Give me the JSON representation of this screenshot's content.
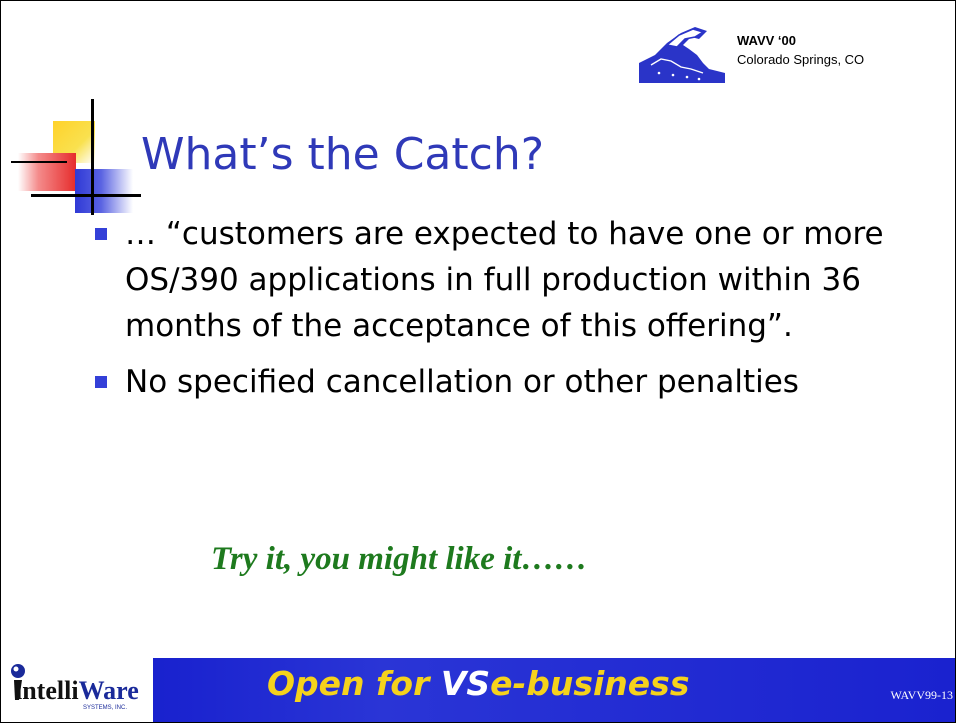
{
  "header": {
    "conference_title": "WAVV ‘00",
    "conference_location": "Colorado Springs, CO",
    "logo_icon": "wavv-mountain-logo"
  },
  "slide": {
    "title": "What’s the Catch?",
    "bullets": [
      "…  “customers are expected to have one or more OS/390 applications in full production within 36 months of the acceptance of this offering”.",
      "No specified cancellation or other penalties"
    ],
    "tagline": "Try it, you might like it……",
    "colors": {
      "title": "#2f39b8",
      "bullet": "#3440d8",
      "tagline": "#1e7a1e"
    }
  },
  "footer": {
    "logo_intelli": "intelli",
    "logo_ware": "Ware",
    "logo_sub": "SYSTEMS, INC.",
    "slogan_yellow": "Open for ",
    "slogan_white": "VS",
    "slogan_yellow2": "e-business",
    "slide_code": "WAVV99-13",
    "colors": {
      "bar": "#0d14c9",
      "slogan": "#f5d21c"
    }
  }
}
